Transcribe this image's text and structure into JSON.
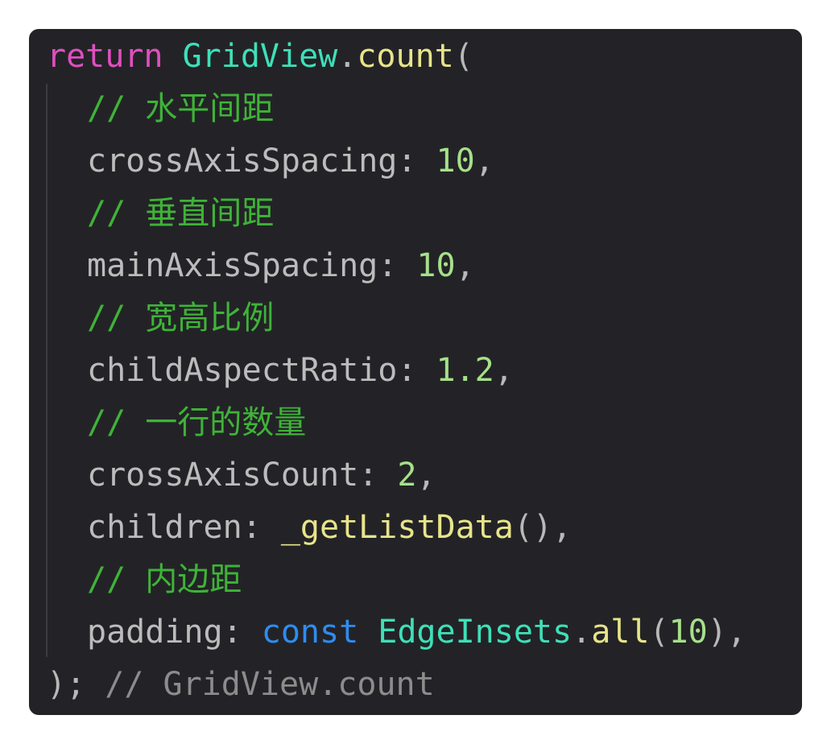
{
  "lines": {
    "l1": {
      "kw": "return",
      "cls": "GridView",
      "dot": ".",
      "fn": "count",
      "paren": "("
    },
    "l2": {
      "comment": "// 水平间距"
    },
    "l3": {
      "prop": "crossAxisSpacing",
      "colon": ": ",
      "num": "10",
      "comma": ","
    },
    "l4": {
      "comment": "// 垂直间距"
    },
    "l5": {
      "prop": "mainAxisSpacing",
      "colon": ": ",
      "num": "10",
      "comma": ","
    },
    "l6": {
      "comment": "// 宽高比例"
    },
    "l7": {
      "prop": "childAspectRatio",
      "colon": ": ",
      "num": "1.2",
      "comma": ","
    },
    "l8": {
      "comment": "// 一行的数量"
    },
    "l9": {
      "prop": "crossAxisCount",
      "colon": ": ",
      "num": "2",
      "comma": ","
    },
    "l10": {
      "prop": "children",
      "colon": ": ",
      "fn": "_getListData",
      "call": "()",
      "comma": ","
    },
    "l11": {
      "comment": "// 内边距"
    },
    "l12": {
      "prop": "padding",
      "colon": ": ",
      "kw": "const",
      "cls": "EdgeInsets",
      "dot": ".",
      "fn": "all",
      "open": "(",
      "num": "10",
      "close": ")",
      "comma": ","
    },
    "l13": {
      "close": ");",
      "comment": "// GridView.count"
    }
  },
  "colors": {
    "background": "#232327",
    "keyword": "#e04fc0",
    "class": "#3ee0b8",
    "function": "#e8e48a",
    "number": "#a6e08a",
    "comment": "#3fb338",
    "const": "#2f8cf0"
  }
}
